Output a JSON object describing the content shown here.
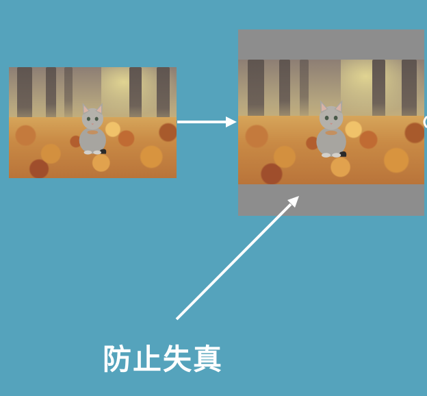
{
  "caption": "防止失真",
  "colors": {
    "background": "#55a3bc",
    "letterbox_padding": "#8d8d8d",
    "arrow": "#ffffff"
  }
}
